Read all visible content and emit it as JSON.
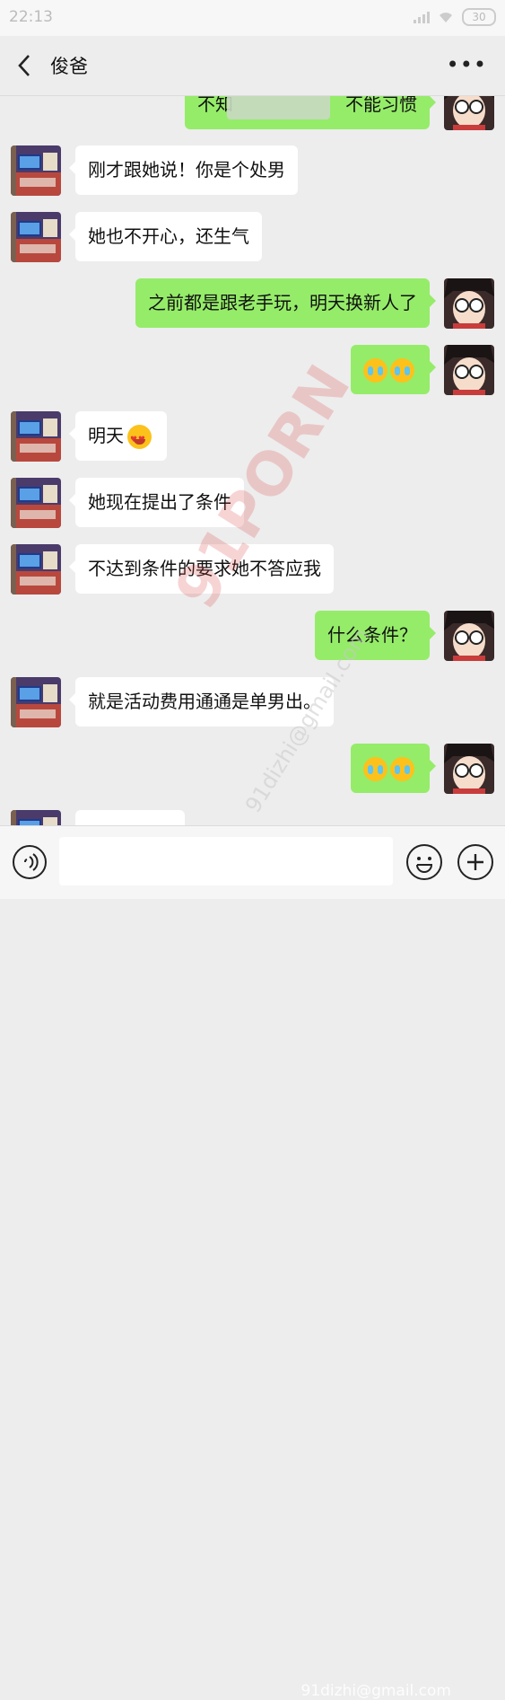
{
  "status_bar": {
    "time": "22:13",
    "battery": "30"
  },
  "header": {
    "title": "俊爸",
    "more": "•••"
  },
  "messages": [
    {
      "side": "right",
      "text": "不知",
      "text_end": "不能习惯",
      "partial": true
    },
    {
      "side": "left",
      "text": "刚才跟她说！你是个处男"
    },
    {
      "side": "left",
      "text": "她也不开心，还生气"
    },
    {
      "side": "right",
      "text": "之前都是跟老手玩，明天换新人了"
    },
    {
      "side": "right",
      "emoji": [
        "cry",
        "cry"
      ]
    },
    {
      "side": "left",
      "text": "明天",
      "emoji": [
        "love"
      ]
    },
    {
      "side": "left",
      "text": "她现在提出了条件"
    },
    {
      "side": "left",
      "text": "不达到条件的要求她不答应我"
    },
    {
      "side": "right",
      "text": "什么条件？"
    },
    {
      "side": "left",
      "text": "就是活动费用通通是单男出。"
    },
    {
      "side": "right",
      "emoji": [
        "cry",
        "cry"
      ]
    },
    {
      "side": "left",
      "text": "",
      "partial": true
    }
  ],
  "watermark": {
    "main": "91PORN",
    "email": "91dizhi@gmail.com",
    "footer": "91dizhi@gmail.com"
  },
  "icons": {
    "back": "chevron-left-icon",
    "more": "more-icon",
    "voice": "voice-icon",
    "emoji": "emoji-icon",
    "plus": "plus-icon"
  },
  "colors": {
    "background": "#ededed",
    "sent_bubble": "#95ec69",
    "received_bubble": "#ffffff"
  }
}
